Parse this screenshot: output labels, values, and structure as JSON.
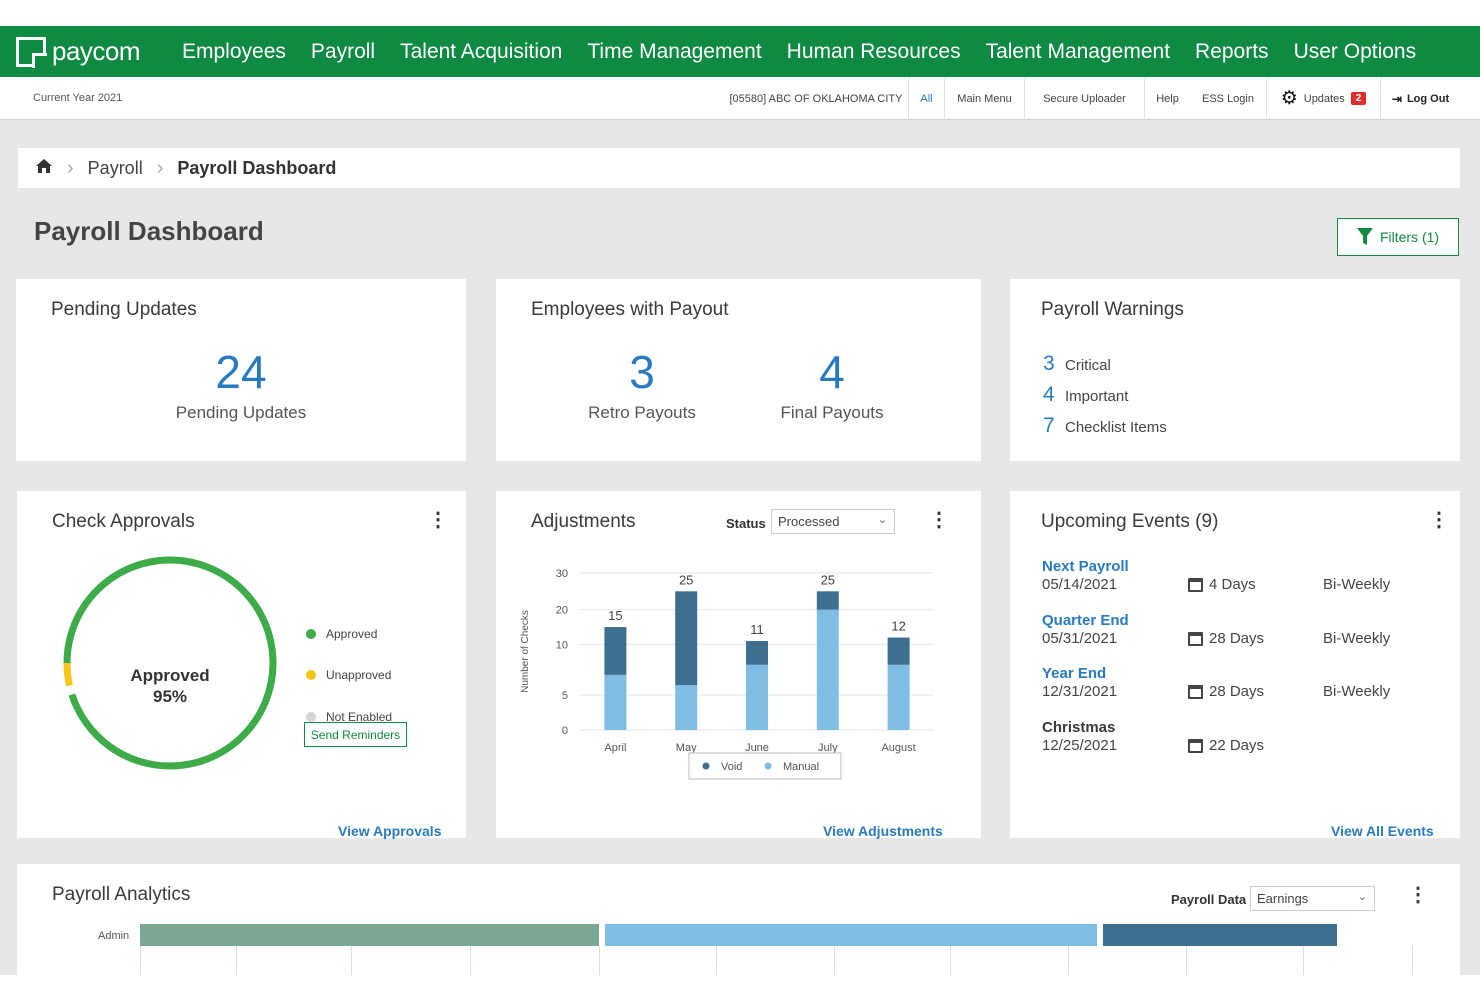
{
  "brand": {
    "name": "paycom"
  },
  "nav": [
    "Employees",
    "Payroll",
    "Talent Acquisition",
    "Time Management",
    "Human Resources",
    "Talent Management",
    "Reports",
    "User Options"
  ],
  "subbar": {
    "current_year": "Current Year 2021",
    "company": "[05580] ABC OF OKLAHOMA CITY",
    "all": "All",
    "main_menu": "Main Menu",
    "secure_uploader": "Secure Uploader",
    "help": "Help",
    "ess_login": "ESS Login",
    "updates": "Updates",
    "updates_count": "2",
    "log_out": "Log Out"
  },
  "breadcrumb": {
    "home_icon": "home-icon",
    "items": [
      "Payroll",
      "Payroll Dashboard"
    ]
  },
  "page_title": "Payroll Dashboard",
  "filters_label": "Filters (1)",
  "pending_updates": {
    "title": "Pending Updates",
    "count": "24",
    "label": "Pending Updates"
  },
  "employees_payout": {
    "title": "Employees with Payout",
    "retro_count": "3",
    "retro_label": "Retro Payouts",
    "final_count": "4",
    "final_label": "Final Payouts"
  },
  "payroll_warnings": {
    "title": "Payroll Warnings",
    "items": [
      {
        "count": "3",
        "label": "Critical"
      },
      {
        "count": "4",
        "label": "Important"
      },
      {
        "count": "7",
        "label": "Checklist Items"
      }
    ]
  },
  "check_approvals": {
    "title": "Check Approvals",
    "center_label": "Approved",
    "center_value": "95%",
    "approved_fraction": 0.95,
    "legend": [
      "Approved",
      "Unapproved",
      "Not Enabled"
    ],
    "colors": {
      "approved": "#3cab48",
      "unapproved": "#f5c518",
      "not_enabled": "#d5d5d5"
    },
    "send_reminders": "Send Reminders",
    "view_link": "View Approvals"
  },
  "adjustments": {
    "title": "Adjustments",
    "status_label": "Status",
    "status_value": "Processed",
    "view_link": "View Adjustments"
  },
  "chart_data": {
    "type": "bar",
    "stacked": true,
    "categories": [
      "April",
      "May",
      "June",
      "July",
      "August"
    ],
    "series": [
      {
        "name": "Manual",
        "values": [
          7,
          6,
          8,
          20,
          8
        ],
        "color": "#7fbde4"
      },
      {
        "name": "Void",
        "values": [
          8,
          19,
          3,
          5,
          4
        ],
        "color": "#3d6f8e"
      }
    ],
    "totals": [
      15,
      25,
      11,
      25,
      12
    ],
    "ylabel": "Number of Checks",
    "yticks": [
      0,
      5,
      10,
      20,
      30
    ],
    "ylim": [
      0,
      30
    ],
    "grid": true,
    "legend_position": "bottom"
  },
  "upcoming_events": {
    "title": "Upcoming Events (9)",
    "events": [
      {
        "name": "Next Payroll",
        "date": "05/14/2021",
        "days": "4 Days",
        "freq": "Bi-Weekly",
        "linked": true
      },
      {
        "name": "Quarter End",
        "date": "05/31/2021",
        "days": "28 Days",
        "freq": "Bi-Weekly",
        "linked": true
      },
      {
        "name": "Year End",
        "date": "12/31/2021",
        "days": "28 Days",
        "freq": "Bi-Weekly",
        "linked": true
      },
      {
        "name": "Christmas",
        "date": "12/25/2021",
        "days": "22 Days",
        "freq": "",
        "linked": false
      }
    ],
    "view_link": "View All Events"
  },
  "analytics": {
    "title": "Payroll Analytics",
    "data_label": "Payroll Data",
    "data_value": "Earnings",
    "row_label": "Admin",
    "segment_colors": [
      "#7ba892",
      "#7fbde4",
      "#3d6f8e"
    ]
  }
}
